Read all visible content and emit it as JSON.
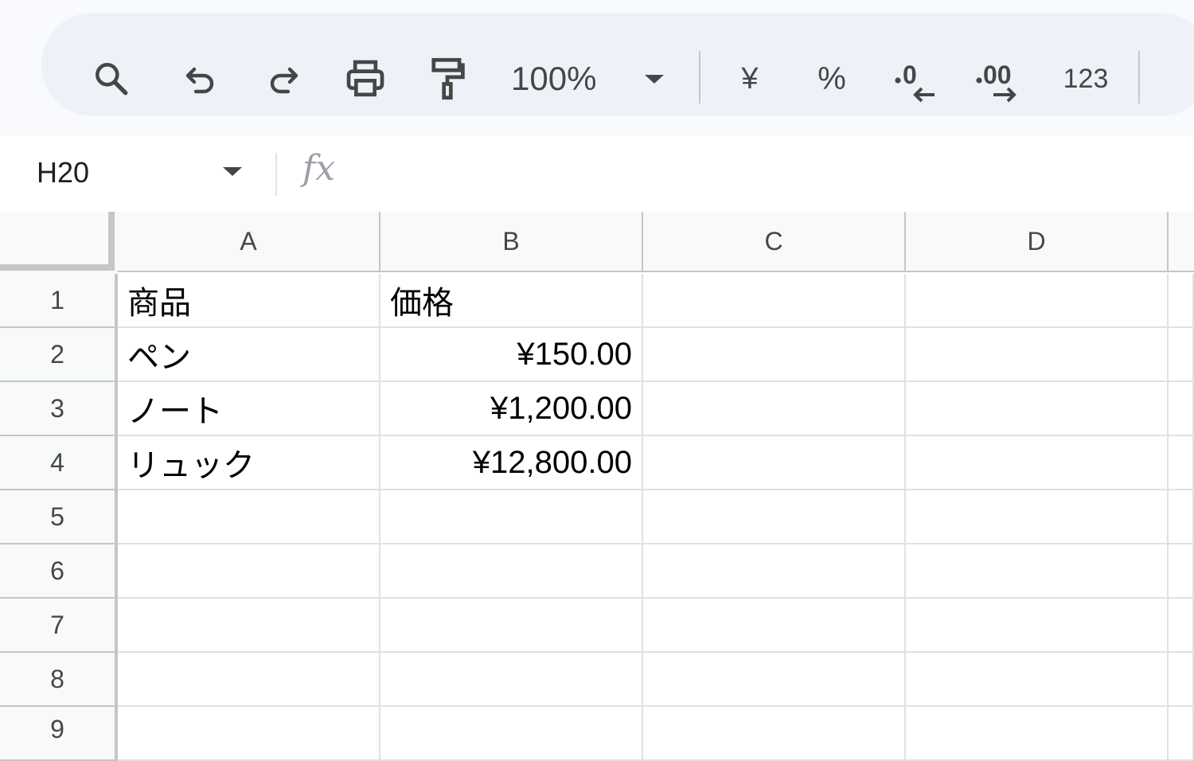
{
  "toolbar": {
    "zoom": "100%",
    "currency_symbol": "¥",
    "percent_symbol": "%",
    "number_format": "123",
    "icons": [
      "search-icon",
      "undo-icon",
      "redo-icon",
      "print-icon",
      "paint-format-icon",
      "zoom-dropdown-icon",
      "currency-format",
      "percent-format",
      "decrease-decimal-icon",
      "increase-decimal-icon",
      "more-formats"
    ]
  },
  "formula_bar": {
    "name_box": "H20",
    "fx_label": "fx",
    "formula": ""
  },
  "columns": [
    "A",
    "B",
    "C",
    "D"
  ],
  "rows": [
    "1",
    "2",
    "3",
    "4",
    "5",
    "6",
    "7",
    "8",
    "9"
  ],
  "cells": {
    "A1": "商品",
    "B1": "価格",
    "A2": "ペン",
    "B2": "¥150.00",
    "A3": "ノート",
    "B3": "¥1,200.00",
    "A4": "リュック",
    "B4": "¥12,800.00"
  },
  "colors": {
    "toolbar_bg": "#eef2f8",
    "header_bg": "#f8f9fa",
    "gridline": "#e1e1e1",
    "header_border": "#c4c7c5"
  }
}
